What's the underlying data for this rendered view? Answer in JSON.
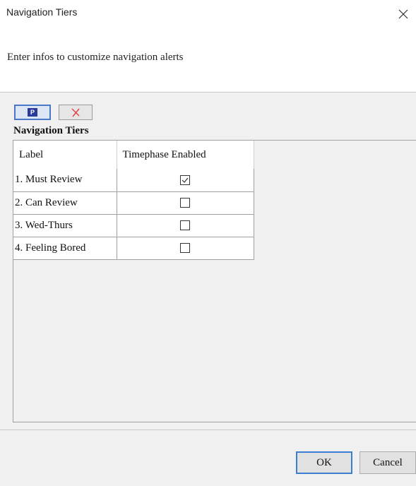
{
  "window": {
    "title": "Navigation Tiers",
    "close_icon": "close-icon"
  },
  "header": {
    "instruction": "Enter infos to customize navigation alerts"
  },
  "toolbar": {
    "buttons": [
      {
        "icon": "p-icon",
        "glyph": "P"
      },
      {
        "icon": "delete-x-icon"
      }
    ]
  },
  "section": {
    "title": "Navigation Tiers"
  },
  "table": {
    "columns": [
      "Label",
      "Timephase Enabled"
    ],
    "rows": [
      {
        "label": "1. Must Review",
        "timephase_enabled": true
      },
      {
        "label": "2. Can Review",
        "timephase_enabled": false
      },
      {
        "label": "3. Wed-Thurs",
        "timephase_enabled": false
      },
      {
        "label": "4. Feeling Bored",
        "timephase_enabled": false
      }
    ]
  },
  "footer": {
    "ok_label": "OK",
    "cancel_label": "Cancel"
  },
  "colors": {
    "delete_icon": "#e04040",
    "p_icon_bg": "#2a3a9a",
    "focus_border": "#3c7fd1"
  }
}
